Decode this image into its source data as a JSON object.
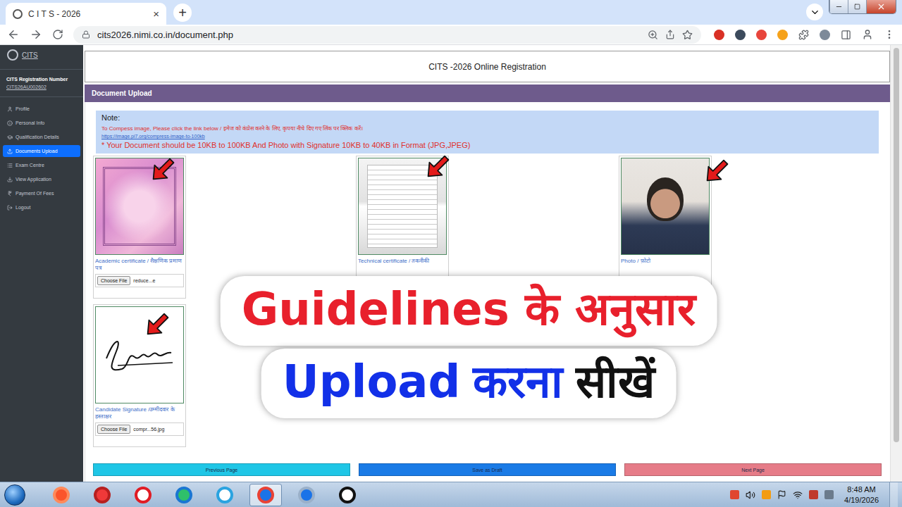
{
  "browser": {
    "tab_title": "C I T S - 2026",
    "tab_close": "×",
    "new_tab": "+",
    "url": "cits2026.nimi.co.in/document.php"
  },
  "sidebar": {
    "logo": "CITS",
    "reg_label": "CITS Registration Number",
    "reg_number": "CITS26AU002602",
    "items": [
      {
        "label": "Profile",
        "selected": false
      },
      {
        "label": "Personal Info",
        "selected": false
      },
      {
        "label": "Qualification Details",
        "selected": false
      },
      {
        "label": "Documents Upload",
        "selected": true
      },
      {
        "label": "Exam Centre",
        "selected": false
      },
      {
        "label": "View Application",
        "selected": false
      },
      {
        "label": "Payment Of Fees",
        "selected": false
      },
      {
        "label": "Logout",
        "selected": false
      }
    ]
  },
  "header": {
    "title": "CITS -2026 Online Registration"
  },
  "section": {
    "title": "Document Upload"
  },
  "note": {
    "title": "Note:",
    "line1": "To Compess image, Please click the link below / इमेज को कंप्रेस करने के लिए, कृपया नीचे दिए गए लिंक पर क्लिक करें।",
    "link": "https://image.pi7.org/compress-image-to-100kb",
    "line2": "* Your Document should be 10KB to 100KB And Photo with Signature 10KB to 40KB in Format (JPG,JPEG)"
  },
  "documents": [
    {
      "kind": "certificate",
      "label": "Academic certificate / शैक्षणिक प्रमाण पत्र",
      "file_button": "Choose File",
      "file_name": "reduce...e"
    },
    {
      "kind": "document",
      "label": "Technical certificate / तकनीकी"
    },
    {
      "kind": "photo",
      "label": "Photo / फ़ोटो"
    },
    {
      "kind": "signature",
      "label": "Candidate Signature /उम्मीदवार के हस्ताक्षर",
      "file_button": "Choose File",
      "file_name": "compr...56.jpg"
    }
  ],
  "buttons": [
    {
      "label": "Previous Page",
      "color": "#1fc6e6"
    },
    {
      "label": "Save as Draft",
      "color": "#1a7be6"
    },
    {
      "label": "Next Page",
      "color": "#e67c88"
    }
  ],
  "overlay": {
    "line1": [
      {
        "text": "Guidelines के अनुसार",
        "color": "#e8202c"
      }
    ],
    "line2": [
      {
        "text": "Upload",
        "color": "#1230e8"
      },
      {
        "text": "करना",
        "color": "#1230e8"
      },
      {
        "text": "सीखें",
        "color": "#111111"
      }
    ]
  },
  "taskbar": {
    "apps": [
      {
        "selected": false
      },
      {
        "selected": false
      },
      {
        "selected": false
      },
      {
        "selected": false
      },
      {
        "selected": false
      },
      {
        "selected": true
      },
      {
        "selected": false
      },
      {
        "selected": false
      }
    ],
    "time": "8:48 AM",
    "date": "4/19/2026"
  }
}
